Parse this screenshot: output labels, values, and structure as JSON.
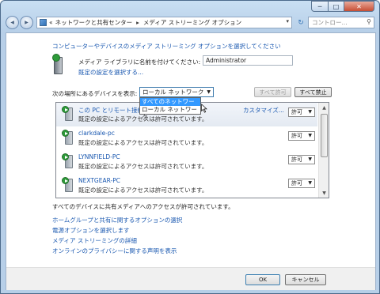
{
  "titlebar": {
    "buttons": {
      "minimize": "─",
      "maximize": "□",
      "close": "✕"
    }
  },
  "toolbar": {
    "back_glyph": "◀",
    "forward_glyph": "▶",
    "breadcrumb": {
      "prefix": "«",
      "item1": "ネットワークと共有センター",
      "separator": "▸",
      "item2": "メディア ストリーミング オプション"
    },
    "search_placeholder": "コントロー..."
  },
  "content": {
    "heading": "コンピューターやデバイスのメディア ストリーミング オプションを選択してください",
    "library_label": "メディア ライブラリに名前を付けてください:",
    "library_value": "Administrator",
    "default_settings_link": "既定の設定を選択する...",
    "show_devices_label": "次の場所にあるデバイスを表示:",
    "location_combo": "ローカル ネットワーク",
    "location_options": [
      "すべてのネットワーク",
      "ローカル ネットワーク"
    ],
    "allow_all_button": "すべて許可",
    "block_all_button": "すべて禁止",
    "devices": [
      {
        "name": "この PC とリモート接続",
        "desc": "既定の設定によるアクセスは許可されています。",
        "customize": "カスタマイズ...",
        "permission": "許可"
      },
      {
        "name": "clarkdale-pc",
        "desc": "既定の設定によるアクセスは許可されています。",
        "permission": "許可"
      },
      {
        "name": "LYNNFIELD-PC",
        "desc": "既定の設定によるアクセスは許可されています。",
        "permission": "許可"
      },
      {
        "name": "NEXTGEAR-PC",
        "desc": "既定の設定によるアクセスは許可されています。",
        "permission": "許可"
      }
    ],
    "status_text": "すべてのデバイスに共有メディアへのアクセスが許可されています。",
    "links": [
      "ホームグループと共有に関するオプションの選択",
      "電源オプションを選択します",
      "メディア ストリーミングの詳細",
      "オンラインのプライバシーに関する声明を表示"
    ],
    "ok_button": "OK",
    "cancel_button": "キャンセル"
  }
}
